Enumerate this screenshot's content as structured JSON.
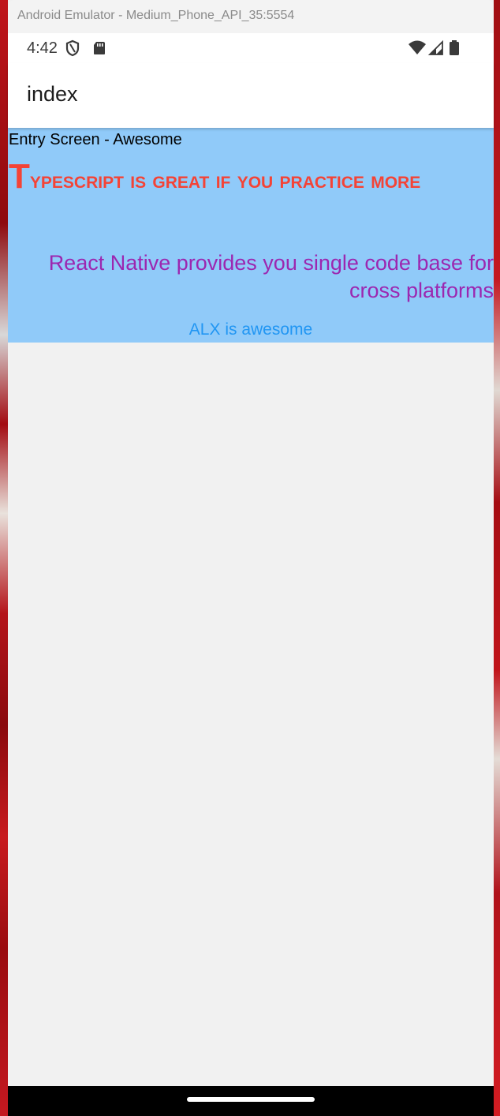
{
  "window": {
    "title": "Android Emulator - Medium_Phone_API_35:5554"
  },
  "status_bar": {
    "time": "4:42",
    "icons_left": [
      "shield-icon",
      "sd-card-icon"
    ],
    "icons_right": [
      "wifi-icon",
      "signal-icon",
      "battery-icon"
    ]
  },
  "app_bar": {
    "title": "index"
  },
  "content": {
    "background": "#90caf9",
    "entry_text": "Entry Screen - Awesome",
    "headline": "Typescript is great if you practice more",
    "headline_color": "#f44336",
    "subtitle": "React Native provides you single code base for cross platforms",
    "subtitle_color": "#9c27b0",
    "footer_text": "ALX is awesome",
    "footer_color": "#2196f3"
  }
}
